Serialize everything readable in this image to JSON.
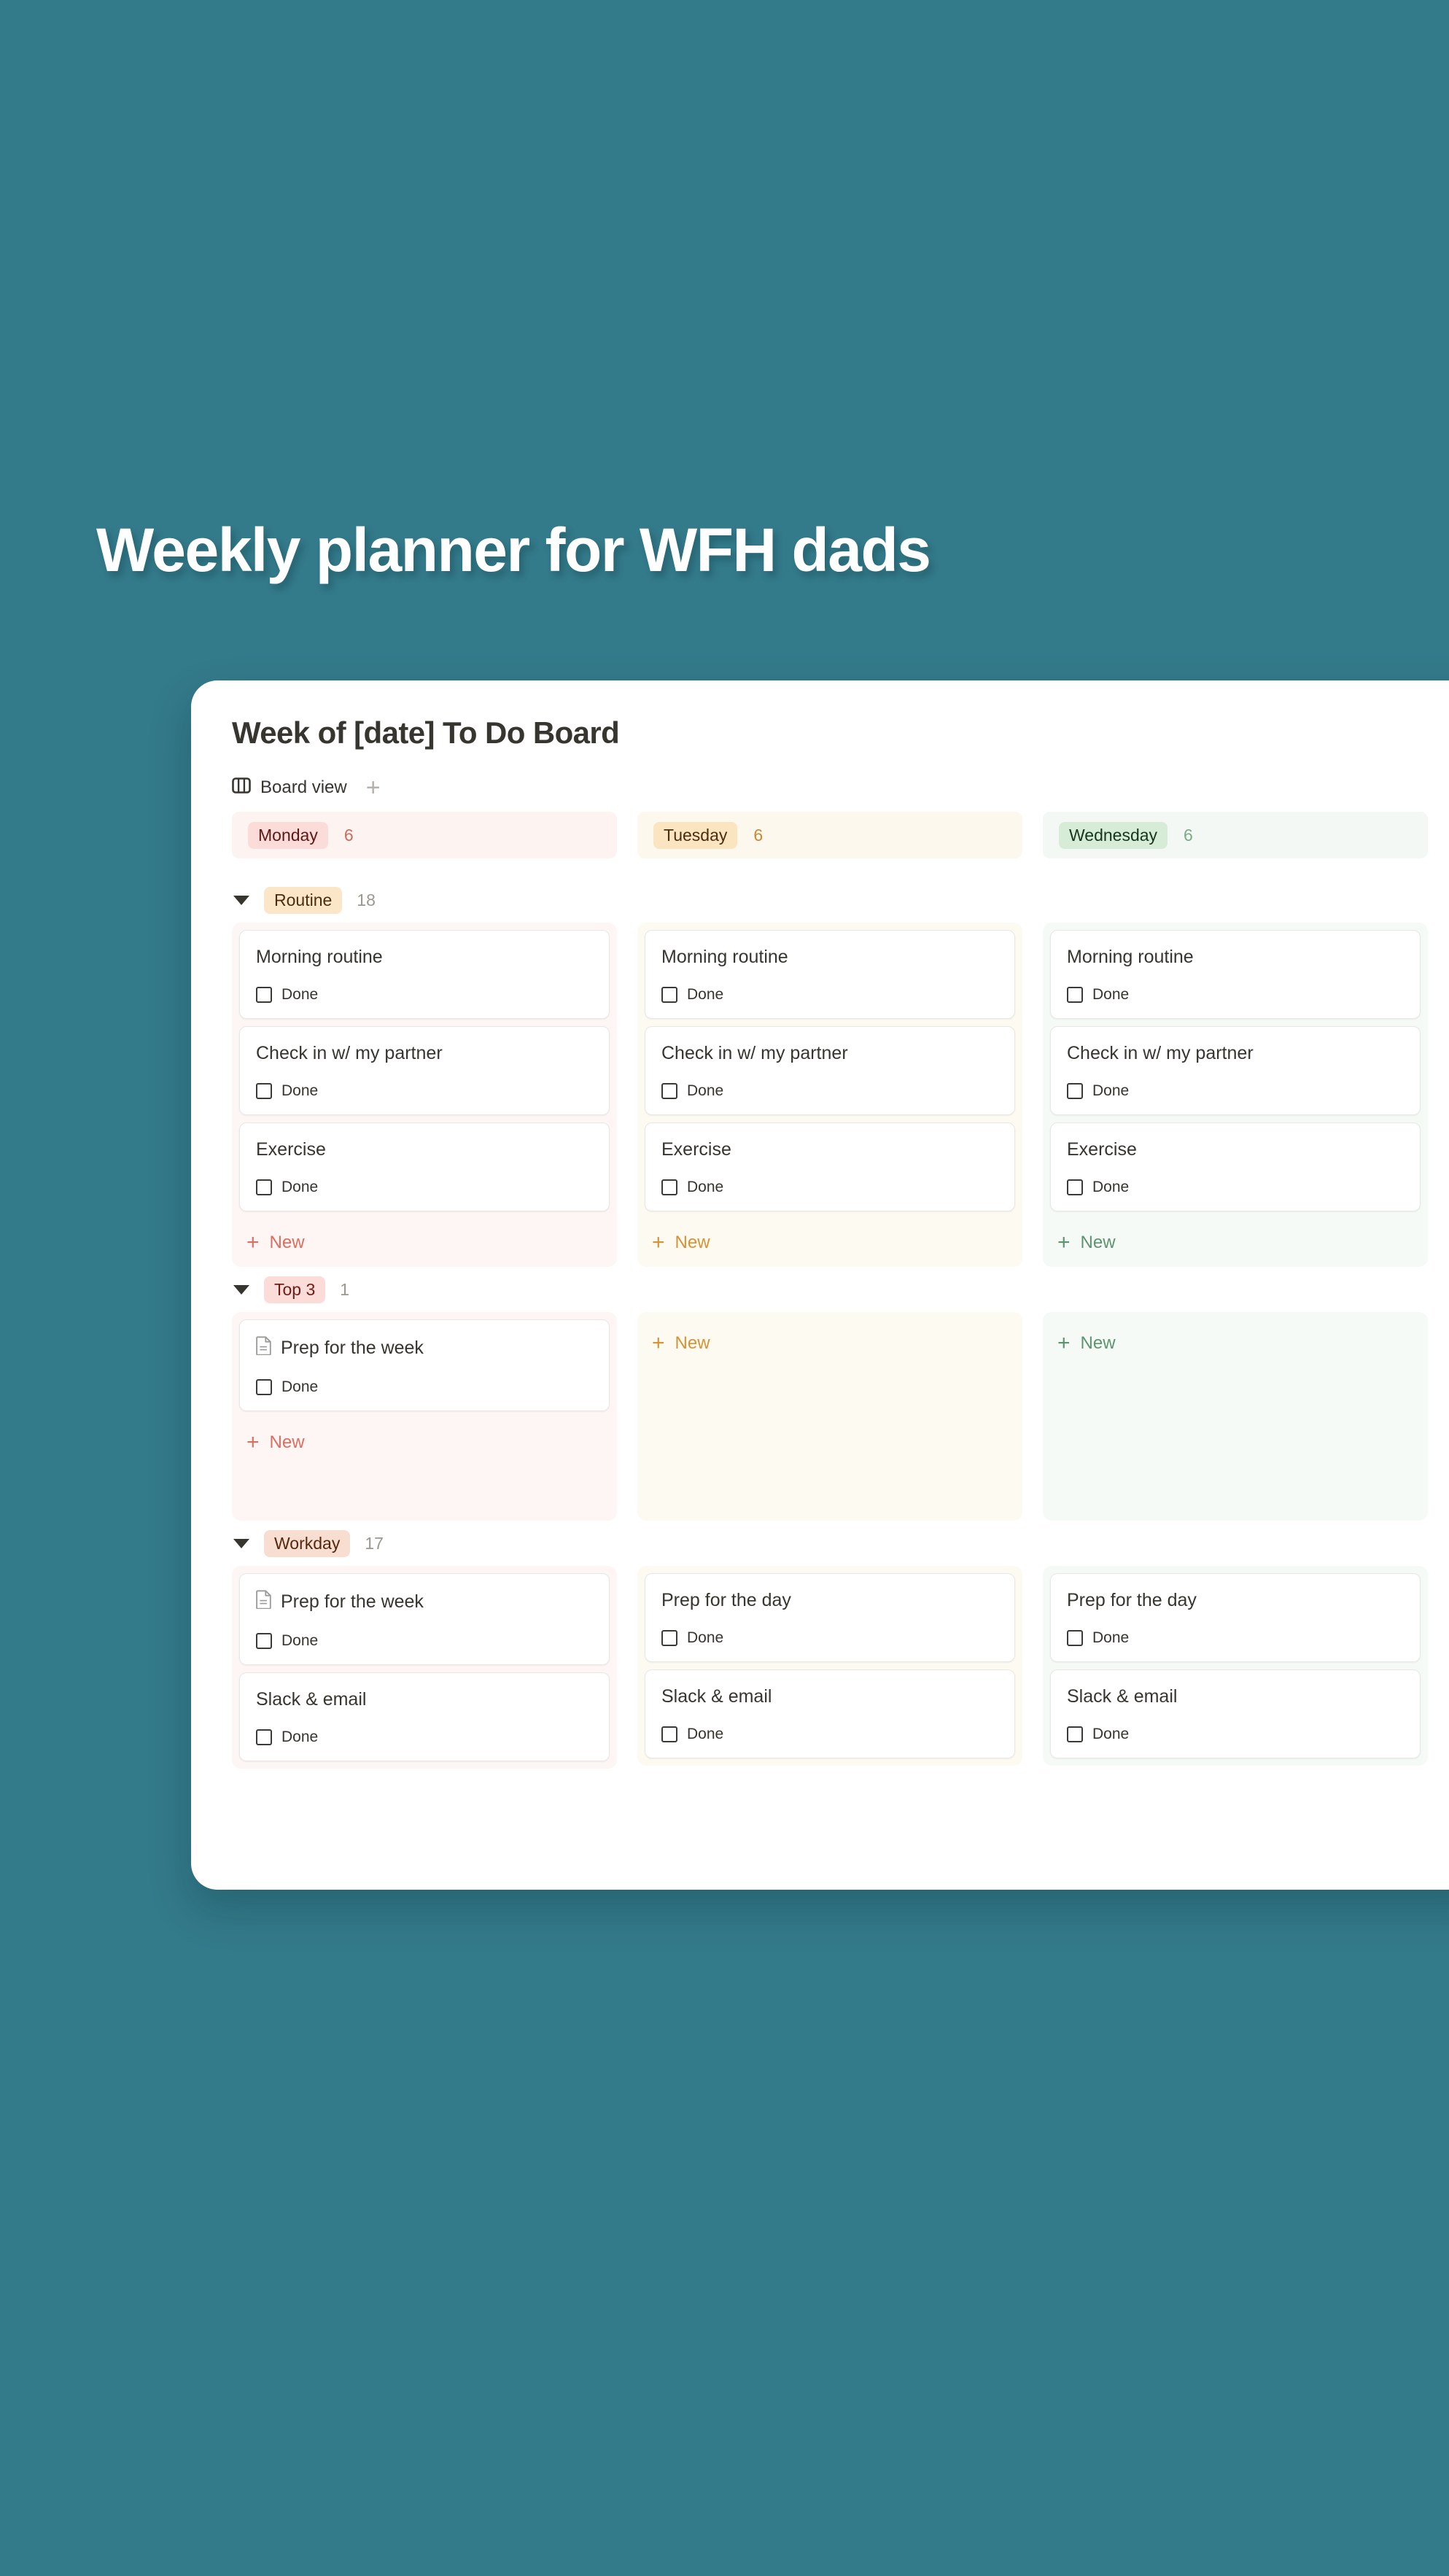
{
  "hero": {
    "title": "Weekly planner for WFH dads"
  },
  "panel": {
    "board_title": "Week of [date] To Do Board",
    "view_tab_label": "Board view",
    "view_tab_icon": "board-view-icon",
    "add_view_label": "+"
  },
  "columns": [
    {
      "key": "monday",
      "label": "Monday",
      "count": "6",
      "accent": "#dd6d5e",
      "pill_bg": "#fbdcd8",
      "pill_fg": "#5d1715",
      "new_label": "New"
    },
    {
      "key": "tuesday",
      "label": "Tuesday",
      "count": "6",
      "accent": "#d59336",
      "pill_bg": "#fae5c0",
      "pill_fg": "#4b2d12",
      "new_label": "New"
    },
    {
      "key": "wednesday",
      "label": "Wednesday",
      "count": "6",
      "accent": "#5d9470",
      "pill_bg": "#d6ecd6",
      "pill_fg": "#17351d",
      "new_label": "New"
    }
  ],
  "check_label": "Done",
  "new_label": "New",
  "groups": [
    {
      "key": "routine",
      "label": "Routine",
      "count": "18",
      "pill_bg": "#fbe7c8",
      "pill_fg": "#4b2d12",
      "cells": [
        {
          "cards": [
            {
              "title": "Morning routine",
              "icon": null,
              "done": false
            },
            {
              "title": "Check in w/ my partner",
              "icon": null,
              "done": false
            },
            {
              "title": "Exercise",
              "icon": null,
              "done": false
            }
          ]
        },
        {
          "cards": [
            {
              "title": "Morning routine",
              "icon": null,
              "done": false
            },
            {
              "title": "Check in w/ my partner",
              "icon": null,
              "done": false
            },
            {
              "title": "Exercise",
              "icon": null,
              "done": false
            }
          ]
        },
        {
          "cards": [
            {
              "title": "Morning routine",
              "icon": null,
              "done": false
            },
            {
              "title": "Check in w/ my partner",
              "icon": null,
              "done": false
            },
            {
              "title": "Exercise",
              "icon": null,
              "done": false
            }
          ]
        }
      ]
    },
    {
      "key": "top3",
      "label": "Top 3",
      "count": "1",
      "pill_bg": "#fbdcd8",
      "pill_fg": "#6f1b18",
      "cells": [
        {
          "cards": [
            {
              "title": "Prep for the week",
              "icon": "document-icon",
              "done": false
            }
          ]
        },
        {
          "cards": []
        },
        {
          "cards": []
        }
      ]
    },
    {
      "key": "workday",
      "label": "Workday",
      "count": "17",
      "pill_bg": "#f8ded0",
      "pill_fg": "#53280f",
      "cells": [
        {
          "cards": [
            {
              "title": "Prep for the week",
              "icon": "document-icon",
              "done": false
            },
            {
              "title": "Slack & email",
              "icon": null,
              "done": false
            }
          ]
        },
        {
          "cards": [
            {
              "title": "Prep for the day",
              "icon": null,
              "done": false
            },
            {
              "title": "Slack & email",
              "icon": null,
              "done": false
            }
          ]
        },
        {
          "cards": [
            {
              "title": "Prep for the day",
              "icon": null,
              "done": false
            },
            {
              "title": "Slack & email",
              "icon": null,
              "done": false
            }
          ]
        }
      ]
    }
  ],
  "colors": {
    "background_teal": "#337a8a",
    "panel_white": "#ffffff",
    "text_primary": "#37352f",
    "text_muted": "#9b988f"
  }
}
